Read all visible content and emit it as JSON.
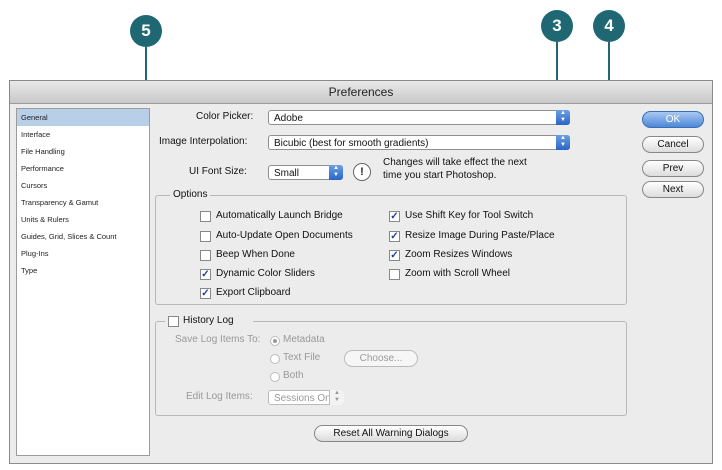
{
  "callouts": [
    "5",
    "3",
    "4"
  ],
  "window": {
    "title": "Preferences"
  },
  "sidebar": {
    "items": [
      {
        "label": "General"
      },
      {
        "label": "Interface"
      },
      {
        "label": "File Handling"
      },
      {
        "label": "Performance"
      },
      {
        "label": "Cursors"
      },
      {
        "label": "Transparency & Gamut"
      },
      {
        "label": "Units & Rulers"
      },
      {
        "label": "Guides, Grid, Slices & Count"
      },
      {
        "label": "Plug-Ins"
      },
      {
        "label": "Type"
      }
    ]
  },
  "general": {
    "color_picker_label": "Color Picker:",
    "color_picker_value": "Adobe",
    "interp_label": "Image Interpolation:",
    "interp_value": "Bicubic (best for smooth gradients)",
    "font_size_label": "UI Font Size:",
    "font_size_value": "Small",
    "font_note_line1": "Changes will take effect the next",
    "font_note_line2": "time you start Photoshop."
  },
  "options": {
    "title": "Options",
    "items": [
      {
        "label": "Automatically Launch Bridge",
        "checked": false
      },
      {
        "label": "Auto-Update Open Documents",
        "checked": false
      },
      {
        "label": "Beep When Done",
        "checked": false
      },
      {
        "label": "Dynamic Color Sliders",
        "checked": true
      },
      {
        "label": "Export Clipboard",
        "checked": true
      },
      {
        "label": "Use Shift Key for Tool Switch",
        "checked": true
      },
      {
        "label": "Resize Image During Paste/Place",
        "checked": true
      },
      {
        "label": "Zoom Resizes Windows",
        "checked": true
      },
      {
        "label": "Zoom with Scroll Wheel",
        "checked": false
      }
    ]
  },
  "history": {
    "title": "History Log",
    "save_to_label": "Save Log Items To:",
    "radio_metadata": "Metadata",
    "radio_text_file": "Text File",
    "choose_button": "Choose...",
    "radio_both": "Both",
    "edit_label": "Edit Log Items:",
    "edit_value": "Sessions Only"
  },
  "buttons": {
    "ok": "OK",
    "cancel": "Cancel",
    "prev": "Prev",
    "next": "Next",
    "reset": "Reset All Warning Dialogs"
  },
  "colors": {
    "callout": "#1f6873",
    "selection": "#b8cfe8",
    "default_button": "#4d88d8"
  }
}
